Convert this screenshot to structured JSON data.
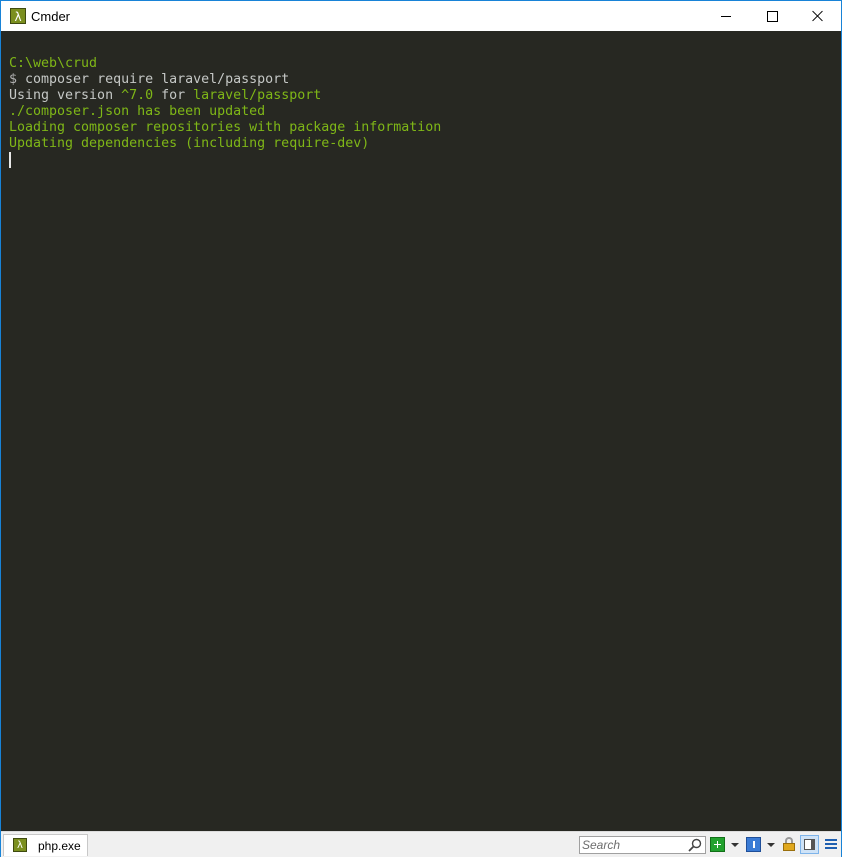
{
  "window": {
    "title": "Cmder",
    "app_icon_glyph": "λ",
    "controls": [
      "minimize",
      "maximize",
      "close"
    ]
  },
  "terminal": {
    "background": "#272822",
    "lines": [
      [
        {
          "text": "C:\\web\\crud",
          "color": "#7fb717"
        }
      ],
      [
        {
          "text": "$ ",
          "color": "#b0b0b0"
        },
        {
          "text": "composer require laravel/passport",
          "color": "#c5c8c6"
        }
      ],
      [
        {
          "text": "Using version ",
          "color": "#c5c8c6"
        },
        {
          "text": "^7.0",
          "color": "#7fb717"
        },
        {
          "text": " for ",
          "color": "#c5c8c6"
        },
        {
          "text": "laravel/passport",
          "color": "#7fb717"
        }
      ],
      [
        {
          "text": "./composer.json has been updated",
          "color": "#7fb717"
        }
      ],
      [
        {
          "text": "Loading composer repositories with package information",
          "color": "#7fb717"
        }
      ],
      [
        {
          "text": "Updating dependencies (including require-dev)",
          "color": "#7fb717"
        }
      ]
    ]
  },
  "statusbar": {
    "tab_label": "php.exe",
    "tab_icon_glyph": "λ",
    "search_placeholder": "Search",
    "icons": [
      "add-tab-icon",
      "console-icon",
      "lock-icon",
      "panel-icon",
      "menu-icon"
    ]
  }
}
